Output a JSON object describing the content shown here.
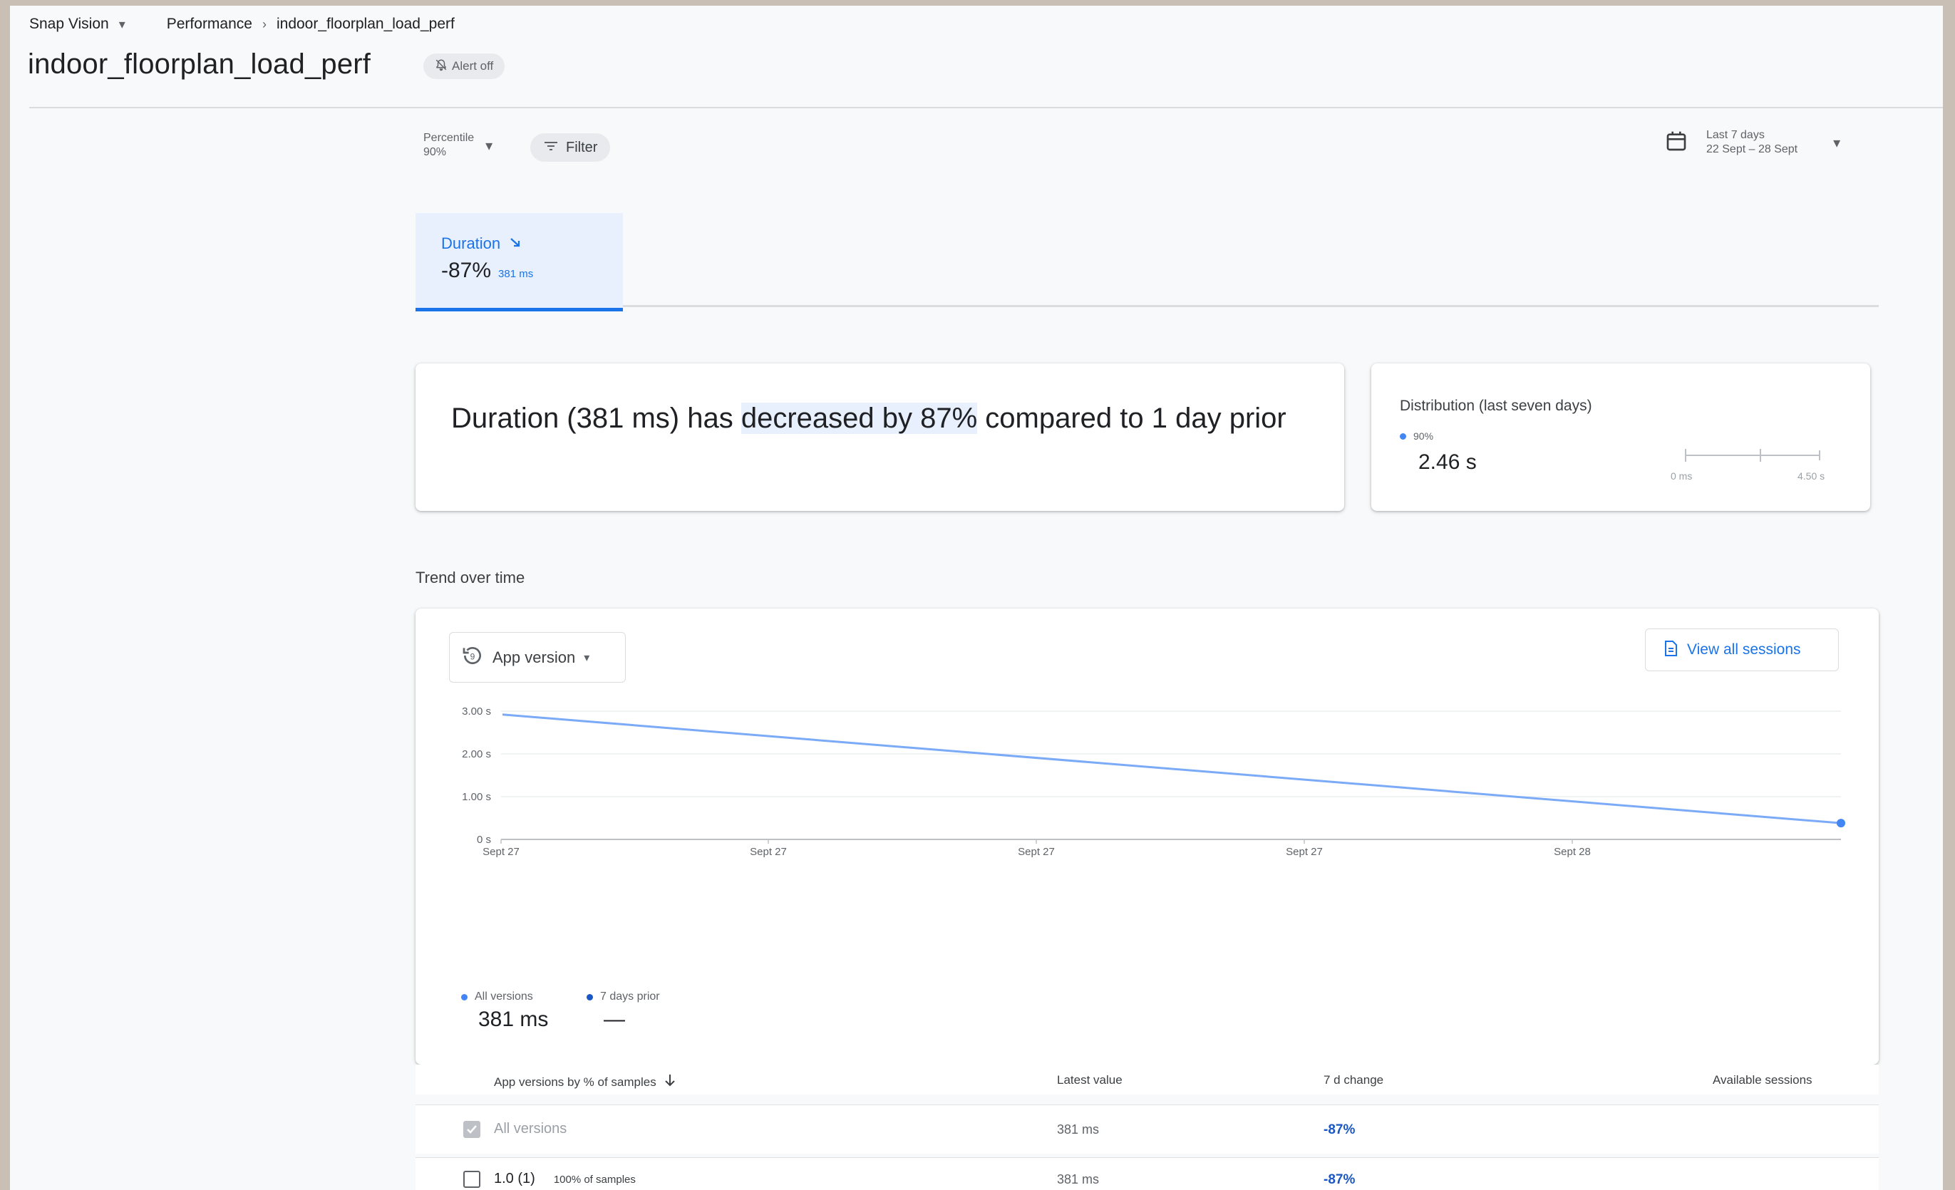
{
  "breadcrumb": {
    "project": "Snap Vision",
    "section": "Performance",
    "current": "indoor_floorplan_load_perf"
  },
  "page": {
    "title": "indoor_floorplan_load_perf",
    "alert_chip": "Alert off"
  },
  "controls": {
    "percentile_label": "Percentile",
    "percentile_value": "90%",
    "filter_label": "Filter",
    "date_range_label": "Last 7 days",
    "date_range_value": "22 Sept – 28 Sept"
  },
  "metric_tab": {
    "label": "Duration",
    "change": "-87%",
    "value": "381 ms"
  },
  "summary": {
    "prefix": "Duration (381 ms) has ",
    "highlight": "decreased by 87%",
    "suffix": " compared to 1 day prior"
  },
  "distribution": {
    "title": "Distribution (last seven days)",
    "legend": "90%",
    "value": "2.46 s",
    "min_label": "0 ms",
    "max_label": "4.50 s",
    "position_fraction": 0.55
  },
  "trend": {
    "section_title": "Trend over time",
    "grouping_dropdown": "App version",
    "view_sessions_button": "View all sessions",
    "legend": [
      {
        "name": "All versions",
        "value": "381 ms",
        "color": "#4285f4"
      },
      {
        "name": "7 days prior",
        "value": "—",
        "color": "#1a56c4"
      }
    ]
  },
  "chart_data": {
    "type": "line",
    "y_ticks": [
      "3.00 s",
      "2.00 s",
      "1.00 s",
      "0 s"
    ],
    "x_ticks": [
      "Sept 27",
      "Sept 27",
      "Sept 27",
      "Sept 27",
      "Sept 28"
    ],
    "ylim": [
      0,
      3
    ],
    "series": [
      {
        "name": "All versions",
        "x": [
          0,
          1
        ],
        "values": [
          2.92,
          0.381
        ],
        "color": "#7baaf7"
      }
    ]
  },
  "versions_table": {
    "headers": [
      "App versions by % of samples",
      "Latest value",
      "7 d change",
      "Available sessions"
    ],
    "rows": [
      {
        "version": "All versions",
        "samples": "",
        "latest": "381 ms",
        "change": "-87%",
        "checked": true
      },
      {
        "version": "1.0 (1)",
        "samples": "100% of samples",
        "latest": "381 ms",
        "change": "-87%",
        "checked": false
      }
    ]
  }
}
